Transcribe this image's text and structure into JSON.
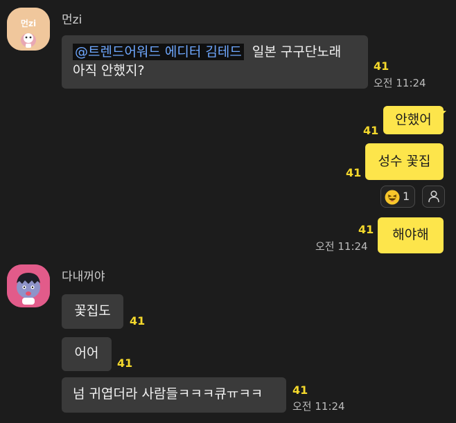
{
  "conversation": {
    "messages_first": {
      "sender": "먼zi",
      "avatar_text": "먼zi",
      "mention": "@트렌드어워드 에디터 김테드",
      "line1_rest": "일본 구구단노래",
      "line2": "아직 안했지?",
      "count": "41",
      "time": "오전 11:24"
    },
    "my_messages": [
      {
        "text": "안했어",
        "count": "41"
      },
      {
        "text": "성수 꽃집",
        "count": "41"
      },
      {
        "text": "해야해",
        "count": "41",
        "time": "오전 11:24"
      }
    ],
    "reaction": {
      "emoji_count": "1"
    },
    "second_sender": {
      "name": "다내꺼야",
      "messages": [
        {
          "text": "꽃집도",
          "count": "41"
        },
        {
          "text": "어어",
          "count": "41"
        },
        {
          "text": "넘 귀엽더라 사람들ㅋㅋㅋ큐ㅠㅋㅋ",
          "count": "41",
          "time": "오전 11:24"
        }
      ]
    }
  },
  "colors": {
    "background": "#1c1c1c",
    "incoming_bubble": "#3a3a3a",
    "outgoing_bubble": "#fde54b",
    "unread_count": "#f5d92c",
    "mention_text": "#6fa8ff"
  }
}
